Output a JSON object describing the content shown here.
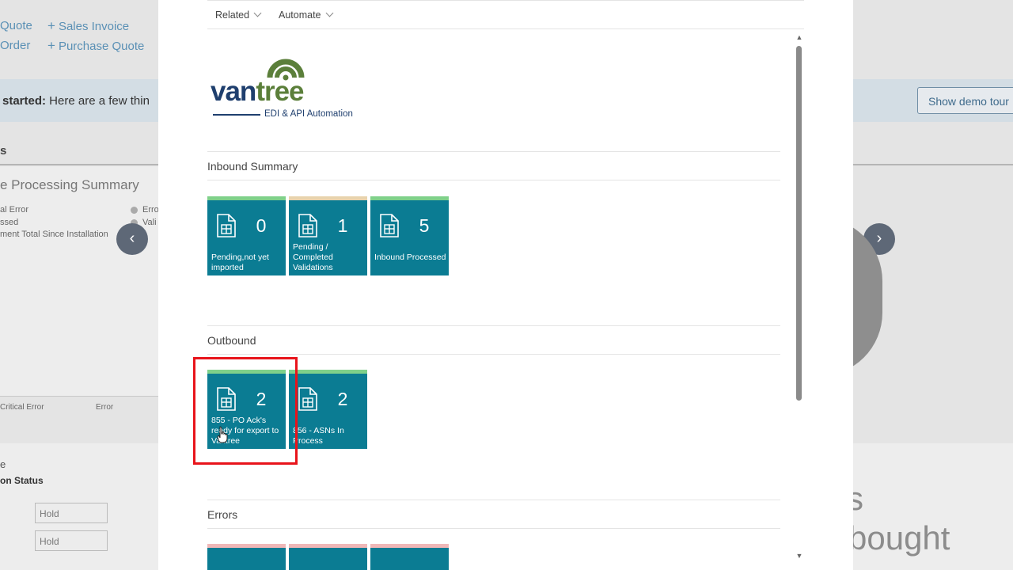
{
  "background": {
    "actions_left": [
      {
        "label": "Quote"
      },
      {
        "label": "Order"
      }
    ],
    "actions_right": [
      {
        "label": "Sales Invoice"
      },
      {
        "label": "Purchase Quote"
      }
    ],
    "banner_bold": "started:",
    "banner_text": " Here are a few thin",
    "demo_button": "Show demo tour",
    "section_s": "s",
    "processing_summary": "e Processing Summary",
    "legend_left": [
      "al Error",
      "ssed",
      "ment Total Since Installation"
    ],
    "legend_right": [
      "Erro",
      "Vali"
    ],
    "bottom_labels": [
      "Critical Error",
      "Error"
    ],
    "section_e": "e",
    "status_label": "on Status",
    "fields": [
      "Hold",
      "Hold"
    ],
    "big_s": "s",
    "big_bought": "bought",
    "prev_icon": "chevron-left-icon",
    "next_icon": "chevron-right-icon"
  },
  "modal": {
    "actions": [
      {
        "label": "Related",
        "icon": "chevron-down-icon"
      },
      {
        "label": "Automate",
        "icon": "chevron-down-icon"
      }
    ],
    "logo": {
      "name": "vantree",
      "tagline": "EDI & API Automation",
      "colors": {
        "dark": "#1f3f6e",
        "green": "#5b7f3a"
      }
    },
    "sections": [
      {
        "title": "Inbound Summary",
        "tiles": [
          {
            "count": "0",
            "label": "Pending,not yet imported",
            "bar_color": "#7fd18a"
          },
          {
            "count": "1",
            "label": "Pending / Completed Validations",
            "bar_color": "#e8d3ad"
          },
          {
            "count": "5",
            "label": "Inbound Processed",
            "bar_color": "#7fd18a"
          }
        ]
      },
      {
        "title": "Outbound",
        "tiles": [
          {
            "count": "2",
            "label": "855 - PO Ack's ready for export to Vantree",
            "bar_color": "#7fd18a",
            "highlighted": true
          },
          {
            "count": "2",
            "label": "856 - ASNs In Process",
            "bar_color": "#7fd18a"
          }
        ]
      },
      {
        "title": "Errors",
        "tiles": [
          {
            "bar_color": "#f0b8b8"
          },
          {
            "bar_color": "#f0b8b8"
          },
          {
            "bar_color": "#f0b8b8"
          }
        ]
      }
    ],
    "tile_color": "#0b7c93",
    "highlight_color": "#e8141b"
  }
}
